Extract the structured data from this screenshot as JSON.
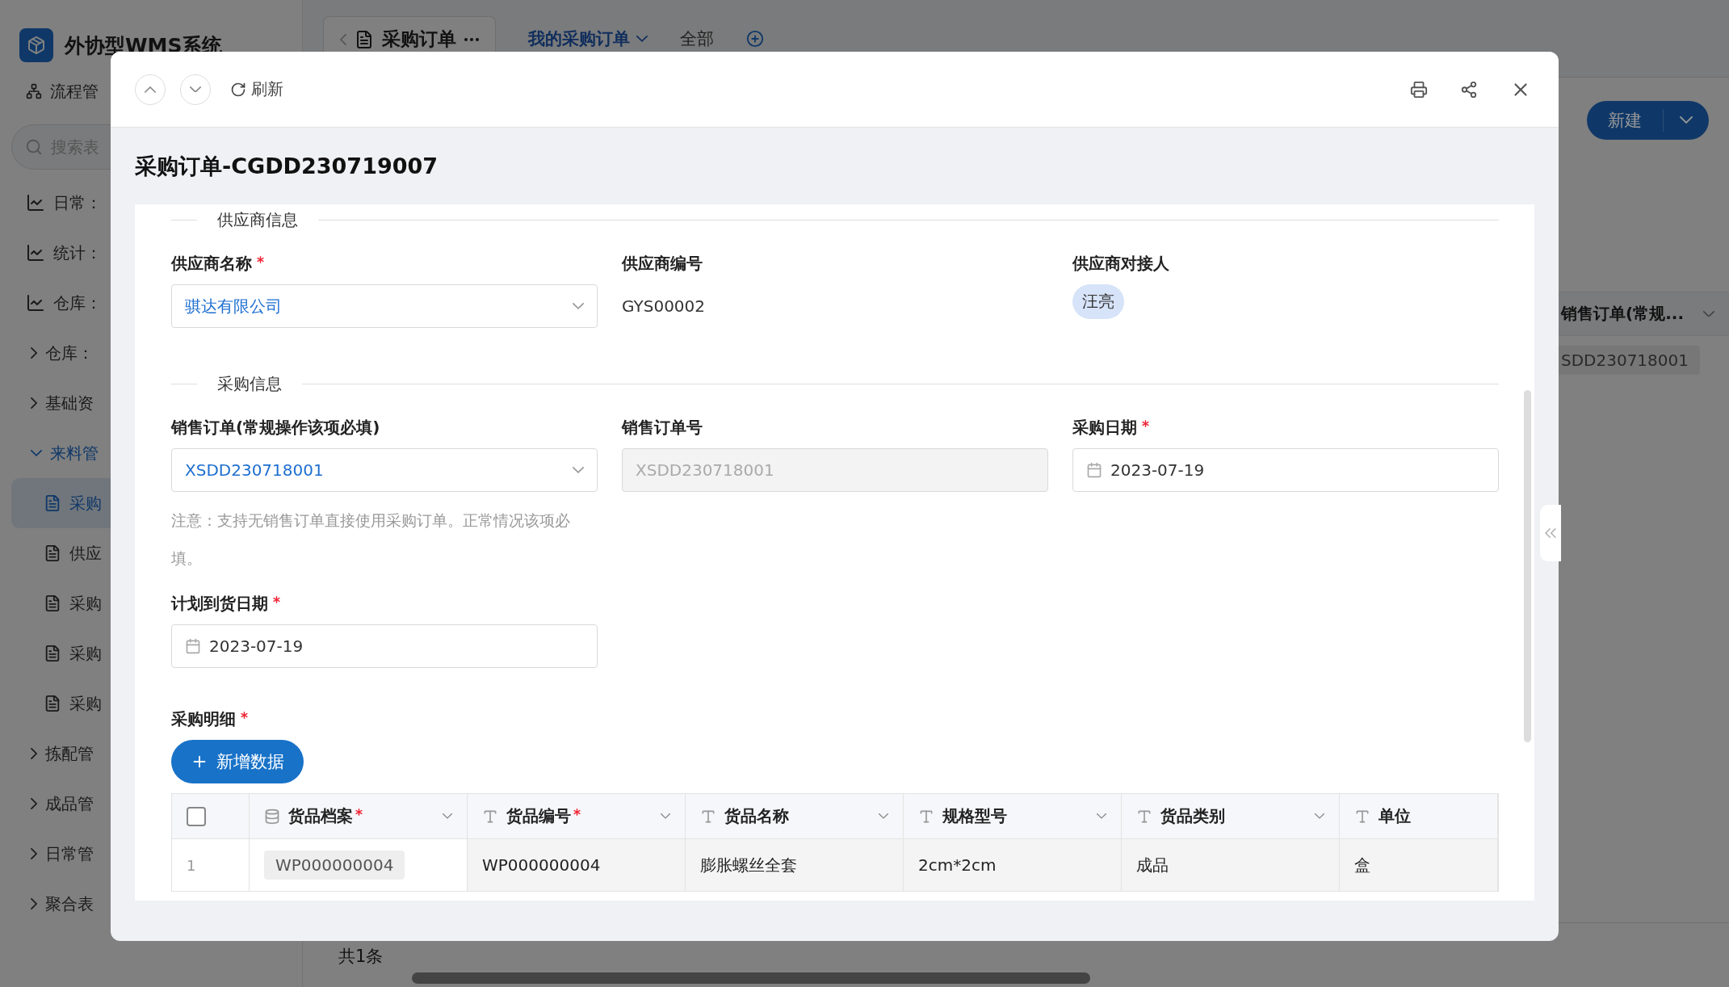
{
  "app": {
    "title": "外协型WMS系统"
  },
  "sidebar": {
    "process_item": "流程管",
    "search": {
      "placeholder": "搜索表"
    },
    "items": [
      {
        "label": "日常：",
        "kind": "chart"
      },
      {
        "label": "统计：",
        "kind": "chart"
      },
      {
        "label": "仓库：",
        "kind": "chart"
      },
      {
        "label": "仓库：",
        "kind": "group",
        "expanded": false
      },
      {
        "label": "基础资",
        "kind": "group",
        "expanded": false
      },
      {
        "label": "来料管",
        "kind": "group",
        "expanded": true,
        "children": [
          {
            "label": "采购",
            "selected": true
          },
          {
            "label": "供应",
            "selected": false
          },
          {
            "label": "采购",
            "selected": false
          },
          {
            "label": "采购",
            "selected": false
          },
          {
            "label": "采购",
            "selected": false
          }
        ]
      },
      {
        "label": "拣配管",
        "kind": "group",
        "expanded": false
      },
      {
        "label": "成品管",
        "kind": "group",
        "expanded": false
      },
      {
        "label": "日常管",
        "kind": "group",
        "expanded": false
      },
      {
        "label": "聚合表",
        "kind": "group",
        "expanded": false
      }
    ]
  },
  "top_bar": {
    "tab": "采购订单",
    "views": [
      {
        "label": "我的采购订单",
        "selected": true
      },
      {
        "label": "全部",
        "selected": false
      }
    ]
  },
  "new_button": "新建",
  "background_table": {
    "column": "销售订单(常规...",
    "cell": "SDD230718001",
    "footer": "共1条"
  },
  "modal": {
    "refresh": "刷新",
    "title": "采购订单-CGDD230719007",
    "sections": [
      {
        "title": "供应商信息",
        "fields": [
          {
            "label": "供应商名称",
            "required": true,
            "kind": "select",
            "value": "骐达有限公司"
          },
          {
            "label": "供应商编号",
            "required": false,
            "kind": "text",
            "value": "GYS00002"
          },
          {
            "label": "供应商对接人",
            "required": false,
            "kind": "tag",
            "value": "汪亮"
          }
        ]
      },
      {
        "title": "采购信息",
        "fields": [
          {
            "label": "销售订单(常规操作该项必填)",
            "required": false,
            "kind": "select",
            "value": "XSDD230718001",
            "note": "注意：支持无销售订单直接使用采购订单。正常情况该项必填。"
          },
          {
            "label": "销售订单号",
            "required": false,
            "kind": "disabled",
            "value": "XSDD230718001"
          },
          {
            "label": "采购日期",
            "required": true,
            "kind": "date",
            "value": "2023-07-19"
          },
          {
            "label": "计划到货日期",
            "required": true,
            "kind": "date",
            "value": "2023-07-19"
          }
        ]
      }
    ],
    "detail": {
      "label": "采购明细",
      "required": true,
      "add_button": "新增数据",
      "header_checked": false,
      "columns": [
        {
          "label": "货品档案",
          "required": true,
          "kind": "database"
        },
        {
          "label": "货品编号",
          "required": true,
          "kind": "text"
        },
        {
          "label": "货品名称",
          "required": false,
          "kind": "text"
        },
        {
          "label": "规格型号",
          "required": false,
          "kind": "text"
        },
        {
          "label": "货品类别",
          "required": false,
          "kind": "text"
        },
        {
          "label": "单位",
          "required": false,
          "kind": "text"
        }
      ],
      "rows": [
        {
          "index": "1",
          "cells": [
            "WP000000004",
            "WP000000004",
            "膨胀螺丝全套",
            "2cm*2cm",
            "成品",
            "盒"
          ]
        }
      ]
    }
  }
}
